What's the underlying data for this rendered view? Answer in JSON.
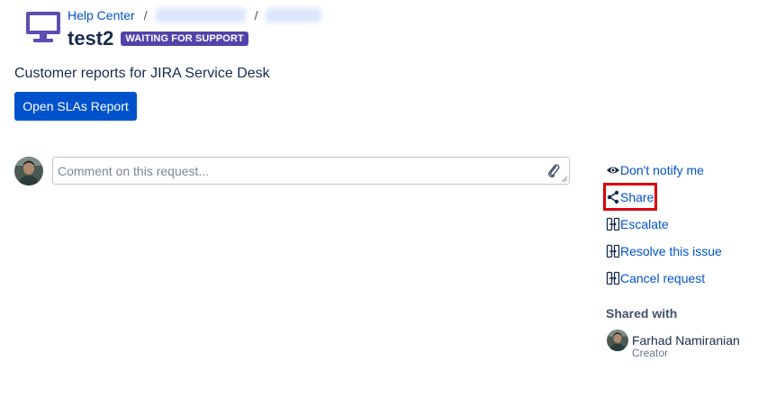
{
  "header": {
    "icon": "monitor-icon",
    "breadcrumb": {
      "home": "Help Center",
      "separator": "/"
    },
    "title": "test2",
    "status": "WAITING FOR SUPPORT"
  },
  "reports": {
    "heading": "Customer reports for JIRA Service Desk",
    "button_label": "Open SLAs Report"
  },
  "comment": {
    "placeholder": "Comment on this request...",
    "attach_icon": "paperclip-icon"
  },
  "actions": [
    {
      "label": "Don't notify me",
      "icon": "eye-icon"
    },
    {
      "label": "Share",
      "icon": "share-icon"
    },
    {
      "label": "Escalate",
      "icon": "transition-icon"
    },
    {
      "label": "Resolve this issue",
      "icon": "transition-icon"
    },
    {
      "label": "Cancel request",
      "icon": "transition-icon"
    }
  ],
  "shared_with": {
    "heading": "Shared with",
    "users": [
      {
        "name": "Farhad Namiranian",
        "role": "Creator"
      }
    ]
  },
  "colors": {
    "link": "#0052cc",
    "primary_button": "#0052cc",
    "status_badge": "#5243aa",
    "monitor_icon": "#5e4db2",
    "highlight_box": "#d9000d",
    "text": "#172b4d"
  }
}
